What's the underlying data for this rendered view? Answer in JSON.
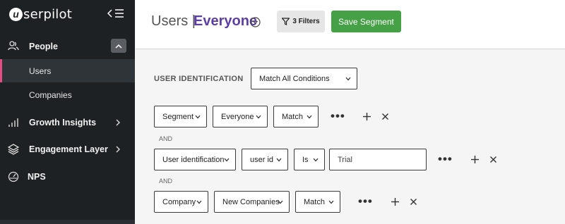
{
  "brand": {
    "logo_letter": "u",
    "logo_text": "serpilot"
  },
  "sidebar": {
    "people": "People",
    "users": "Users",
    "companies": "Companies",
    "growth": "Growth Insights",
    "engagement": "Engagement Layer",
    "nps": "NPS"
  },
  "header": {
    "title": "Users",
    "separator": "|",
    "segment": "Everyone",
    "filters": "3 Filters",
    "save": "Save Segment"
  },
  "main": {
    "section_label": "USER IDENTIFICATION",
    "match_mode": "Match All Conditions",
    "and_label": "AND",
    "rows": [
      {
        "field": "Segment",
        "value": "Everyone",
        "op": "Match"
      },
      {
        "field": "User identification",
        "attr": "user id",
        "op": "Is",
        "input": "Trial"
      },
      {
        "field": "Company",
        "value": "New Companies",
        "op": "Match"
      }
    ],
    "more": "•••"
  },
  "colors": {
    "accent": "#5d3fa3",
    "save": "#46a046",
    "active": "#e44d83",
    "sidebar": "#1e2124"
  }
}
